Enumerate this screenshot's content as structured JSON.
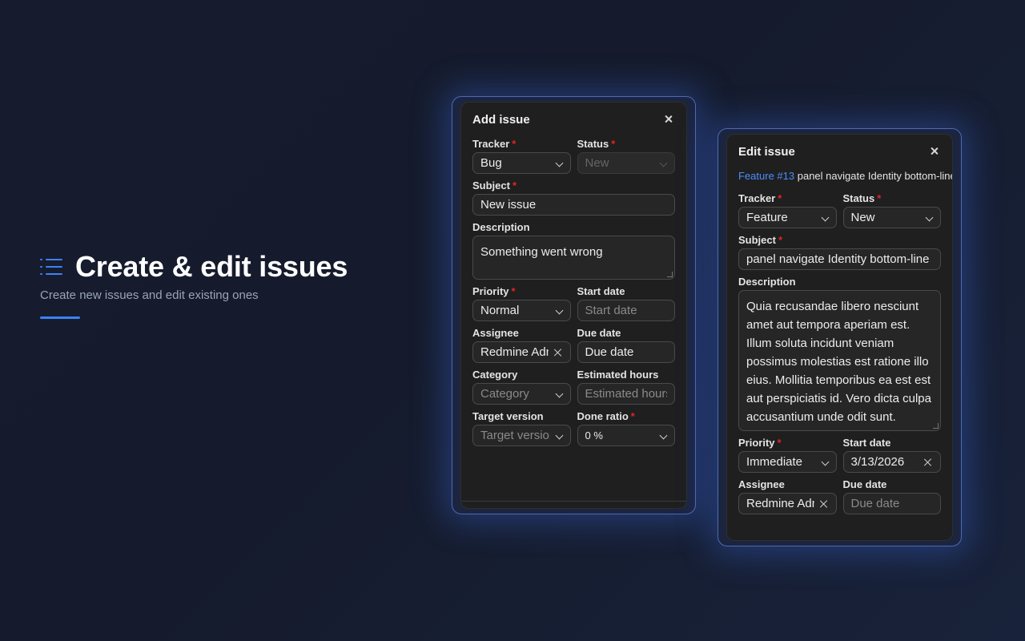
{
  "hero": {
    "title": "Create & edit issues",
    "subtitle": "Create new issues and edit existing ones",
    "icon": "list-icon",
    "accent": "#3b82f6"
  },
  "add_panel": {
    "title": "Add issue",
    "tracker_label": "Tracker",
    "tracker_value": "Bug",
    "status_label": "Status",
    "status_value": "New",
    "subject_label": "Subject",
    "subject_value": "New issue",
    "description_label": "Description",
    "description_value": "Something went wrong",
    "priority_label": "Priority",
    "priority_value": "Normal",
    "start_date_label": "Start date",
    "start_date_placeholder": "Start date",
    "assignee_label": "Assignee",
    "assignee_value": "Redmine Admin",
    "due_date_label": "Due date",
    "due_date_value": "Due date",
    "category_label": "Category",
    "category_placeholder": "Category",
    "estimated_hours_label": "Estimated hours",
    "estimated_hours_placeholder": "Estimated hours",
    "target_version_label": "Target version",
    "target_version_placeholder": "Target version",
    "done_ratio_label": "Done ratio",
    "done_ratio_value": "0 %"
  },
  "edit_panel": {
    "title": "Edit issue",
    "issue_link": "Feature #13",
    "issue_subject": "panel navigate Identity bottom-line",
    "tracker_label": "Tracker",
    "tracker_value": "Feature",
    "status_label": "Status",
    "status_value": "New",
    "subject_label": "Subject",
    "subject_value": "panel navigate Identity bottom-line",
    "description_label": "Description",
    "description_value": "Quia recusandae libero nesciunt amet aut tempora aperiam est. Illum soluta incidunt veniam possimus molestias est ratione illo eius. Mollitia temporibus ea est est aut perspiciatis id. Vero dicta culpa accusantium unde odit sunt.",
    "priority_label": "Priority",
    "priority_value": "Immediate",
    "start_date_label": "Start date",
    "start_date_value": "3/13/2026",
    "assignee_label": "Assignee",
    "assignee_value": "Redmine Admin",
    "due_date_label": "Due date",
    "due_date_placeholder": "Due date"
  },
  "colors": {
    "link": "#4c8dff",
    "required": "#e02424",
    "panel_bg": "#1f1f1f"
  }
}
